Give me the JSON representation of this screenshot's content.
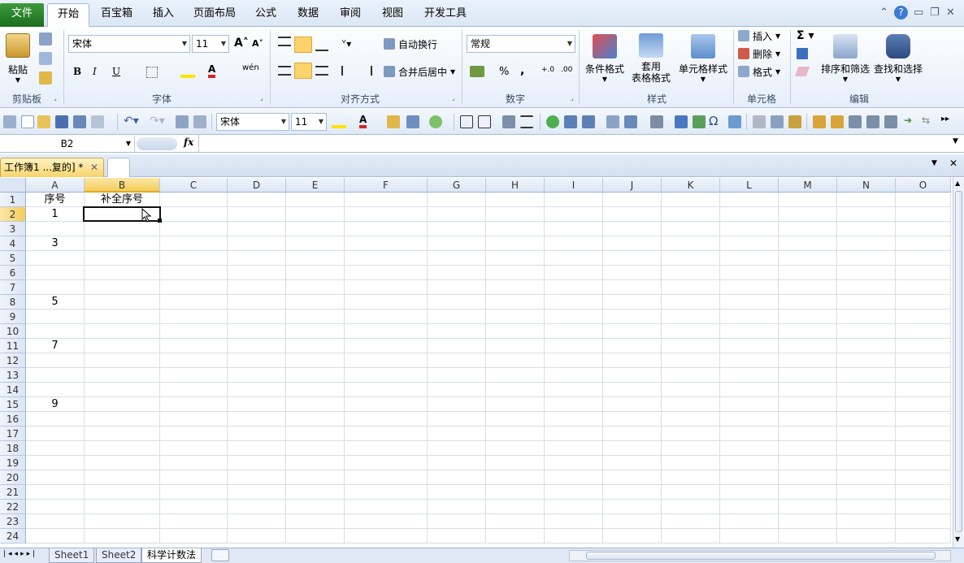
{
  "ribbon_tabs": [
    "文件",
    "开始",
    "百宝箱",
    "插入",
    "页面布局",
    "公式",
    "数据",
    "审阅",
    "视图",
    "开发工具"
  ],
  "active_tab": "开始",
  "clipboard": {
    "paste": "粘贴",
    "group": "剪贴板"
  },
  "font": {
    "name": "宋体",
    "size": "11",
    "group": "字体"
  },
  "alignment": {
    "wrap": "自动换行",
    "merge": "合并后居中",
    "group": "对齐方式"
  },
  "number": {
    "format": "常规",
    "group": "数字"
  },
  "styles": {
    "conditional": "条件格式",
    "table_line1": "套用",
    "table_line2": "表格格式",
    "cell_styles": "单元格样式",
    "group": "样式"
  },
  "cells": {
    "insert": "插入",
    "delete": "删除",
    "format": "格式",
    "group": "单元格"
  },
  "editing": {
    "sort": "排序和筛选",
    "find": "查找和选择",
    "group": "编辑"
  },
  "toolbar": {
    "font_name": "宋体",
    "font_size": "11"
  },
  "formula_bar": {
    "name_box": "B2",
    "fx": "fx",
    "content": ""
  },
  "doc_tab": {
    "title": "工作簿1 ...复的] *"
  },
  "grid": {
    "columns": [
      "A",
      "B",
      "C",
      "D",
      "E",
      "F",
      "G",
      "H",
      "I",
      "J",
      "K",
      "L",
      "M",
      "N",
      "O"
    ],
    "rows": [
      "1",
      "2",
      "3",
      "4",
      "5",
      "6",
      "7",
      "8",
      "9",
      "10",
      "11",
      "12",
      "13",
      "14",
      "15",
      "16",
      "17",
      "18",
      "19",
      "20",
      "21",
      "22",
      "23",
      "24"
    ],
    "selected_cell": "B2",
    "cells": {
      "A1": "序号",
      "B1": "补全序号",
      "A2": "1",
      "A4": "3",
      "A8": "5",
      "A11": "7",
      "A15": "9"
    }
  },
  "sheets": [
    "Sheet1",
    "Sheet2",
    "科学计数法"
  ],
  "active_sheet": "科学计数法",
  "colors": {
    "accent_green": "#2e8a2e",
    "selection": "#f4cd58",
    "header_bg": "#dce6f4"
  }
}
